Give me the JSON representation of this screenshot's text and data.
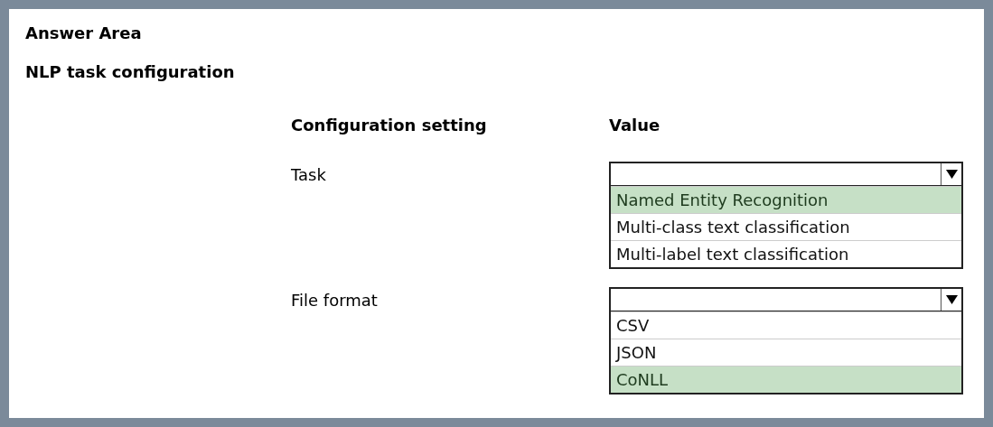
{
  "title": "Answer Area",
  "subtitle": "NLP task configuration",
  "columns": [
    "Configuration setting",
    "Value"
  ],
  "settings": [
    {
      "label": "Task",
      "options": [
        {
          "label": "Named Entity Recognition",
          "selected": true
        },
        {
          "label": "Multi-class text classification",
          "selected": false
        },
        {
          "label": "Multi-label text classification",
          "selected": false
        }
      ]
    },
    {
      "label": "File format",
      "options": [
        {
          "label": "CSV",
          "selected": false
        },
        {
          "label": "JSON",
          "selected": false
        },
        {
          "label": "CoNLL",
          "selected": true
        }
      ]
    }
  ]
}
